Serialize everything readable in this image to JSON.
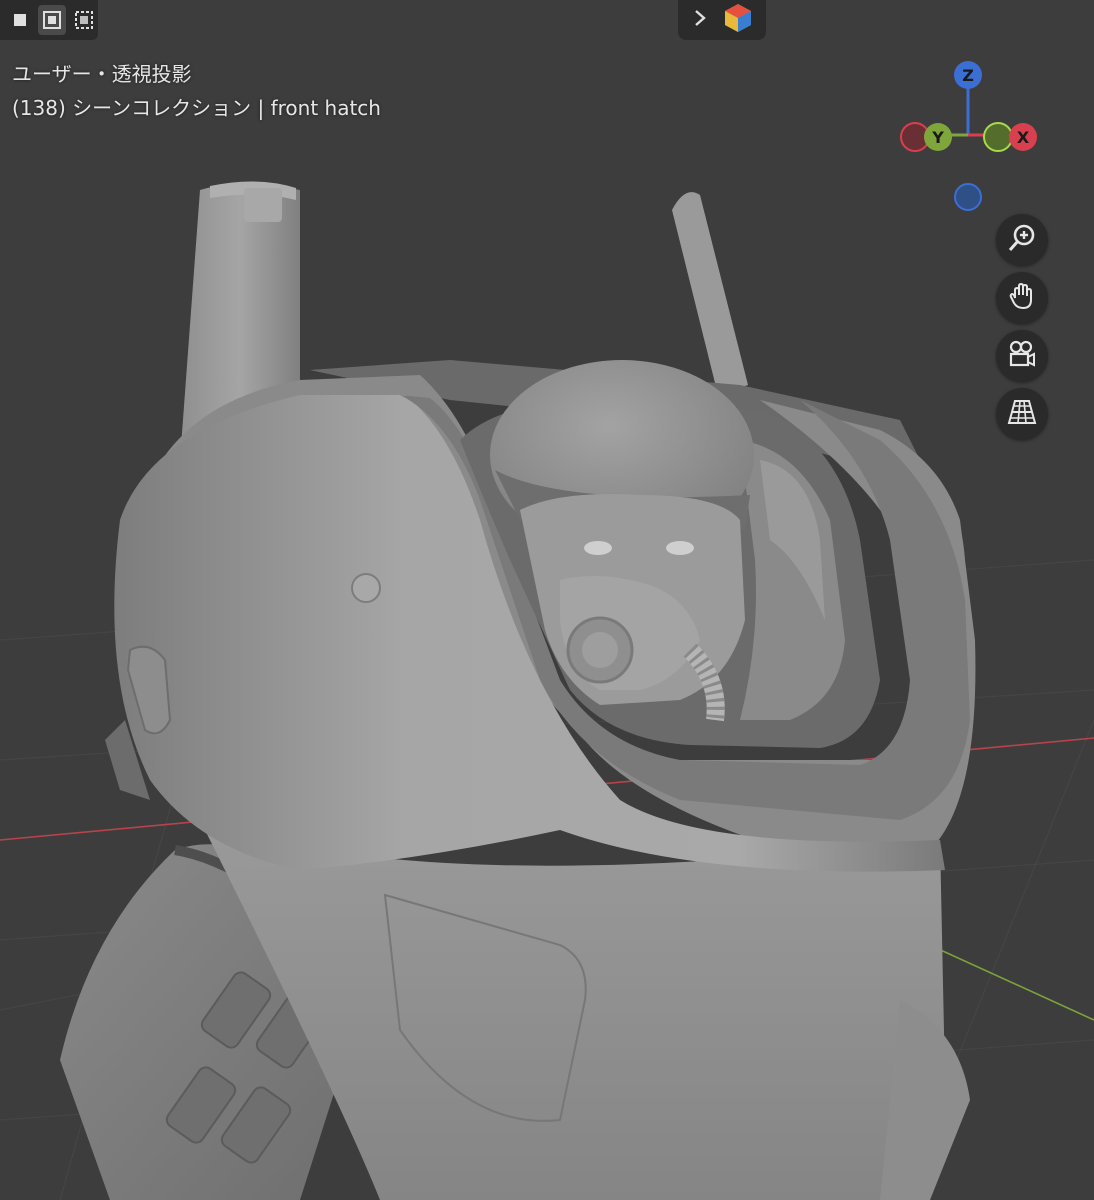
{
  "viewport": {
    "view_name": "ユーザー・透視投影",
    "scene_info": "(138) シーンコレクション | front hatch"
  },
  "gizmo": {
    "axes": [
      {
        "label": "Z",
        "color": "#3b6fd4"
      },
      {
        "label": "Y",
        "color": "#7fa63a"
      },
      {
        "label": "X",
        "color": "#d9404f"
      }
    ]
  },
  "toolbar": {
    "icons": [
      "select-box-icon",
      "select-extend-icon",
      "select-subtract-icon"
    ]
  },
  "header_pill": {
    "icons": [
      "chevron-right-icon",
      "viewport-shading-icon"
    ]
  },
  "nav_buttons": {
    "icons": [
      "zoom-icon",
      "pan-hand-icon",
      "camera-view-icon",
      "grid-perspective-icon"
    ]
  },
  "colors": {
    "background": "#3d3d3d",
    "panel": "#2b2b2b",
    "model": "#9d9d9d",
    "axis_red": "#b8434c",
    "axis_green": "#7da33a"
  }
}
